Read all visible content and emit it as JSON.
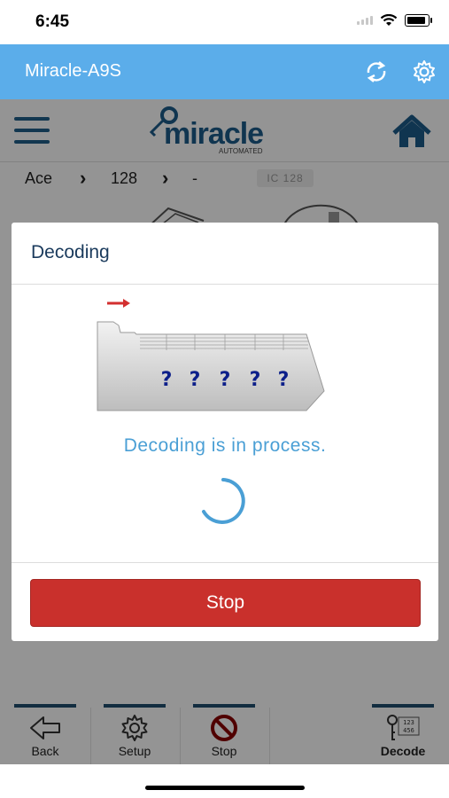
{
  "status_bar": {
    "time": "6:45"
  },
  "app_bar": {
    "title": "Miracle-A9S"
  },
  "logo": {
    "text": "miracle",
    "subtext": "AUTOMATED"
  },
  "breadcrumb": {
    "brand": "Ace",
    "model": "128",
    "detail": "-",
    "badge": "IC 128"
  },
  "dialog": {
    "title": "Decoding",
    "key_cuts": [
      "?",
      "?",
      "?",
      "?",
      "?"
    ],
    "message": "Decoding is in process.",
    "stop_label": "Stop"
  },
  "bottom_nav": {
    "back": "Back",
    "setup": "Setup",
    "stop": "Stop",
    "decode": "Decode",
    "decode_icon_digits": [
      "123",
      "456"
    ]
  },
  "colors": {
    "app_bar": "#5badea",
    "brand_blue": "#1d5c8a",
    "stop_red": "#c9302c",
    "message_blue": "#4a9fd5"
  }
}
